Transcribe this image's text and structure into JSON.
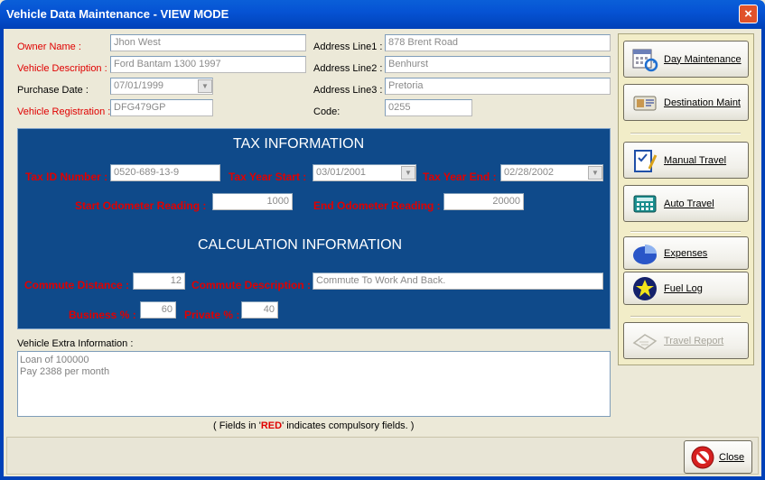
{
  "window": {
    "title": "Vehicle Data Maintenance - VIEW MODE",
    "close_glyph": "×"
  },
  "owner": {
    "owner_name_label": "Owner Name :",
    "owner_name": "Jhon West",
    "vehicle_description_label": "Vehicle Description :",
    "vehicle_description": "Ford Bantam 1300 1997",
    "purchase_date_label": "Purchase Date :",
    "purchase_date": "07/01/1999",
    "vehicle_registration_label": "Vehicle Registration :",
    "vehicle_registration": "DFG479GP"
  },
  "address": {
    "line1_label": "Address Line1 :",
    "line1": "878 Brent Road",
    "line2_label": "Address Line2 :",
    "line2": "Benhurst",
    "line3_label": "Address Line3 :",
    "line3": "Pretoria",
    "code_label": "Code:",
    "code": "0255"
  },
  "tax": {
    "heading": "TAX INFORMATION",
    "tax_id_label": "Tax ID Number :",
    "tax_id": "0520-689-13-9",
    "year_start_label": "Tax Year Start :",
    "year_start": "03/01/2001",
    "year_end_label": "Tax Year End :",
    "year_end": "02/28/2002",
    "start_odo_label": "Start Odometer Reading :",
    "start_odo": "1000",
    "end_odo_label": "End Odometer Reading :",
    "end_odo": "20000"
  },
  "calc": {
    "heading": "CALCULATION INFORMATION",
    "commute_distance_label": "Commute Distance :",
    "commute_distance": "12",
    "commute_description_label": "Commute Description :",
    "commute_description": "Commute To Work And Back.",
    "business_label": "Business % :",
    "business": "60",
    "private_label": "Private % :",
    "private": "40"
  },
  "extra": {
    "label": "Vehicle Extra Information :",
    "lines": [
      "Loan of 100000",
      "Pay 2388 per month"
    ]
  },
  "footnote": {
    "prefix": "( Fields in '",
    "red_word": "RED",
    "suffix": "' indicates compulsory fields. )"
  },
  "buttons": {
    "day_maintenance": "Day Maintenance",
    "destination_maint": "Destination Maint",
    "manual_travel": "Manual Travel",
    "auto_travel": "Auto Travel",
    "expenses": "Expenses",
    "fuel_log": "Fuel Log",
    "travel_report": "Travel Report",
    "close": "Close"
  },
  "colors": {
    "panel_blue": "#0F4A8A",
    "required_red": "#E00000",
    "titlebar_blue": "#0653D4"
  },
  "icons": [
    "calendar-refresh-icon",
    "destination-card-icon",
    "clipboard-pen-icon",
    "calculator-icon",
    "pie-chart-icon",
    "fuel-star-icon",
    "report-icon",
    "no-entry-icon"
  ]
}
